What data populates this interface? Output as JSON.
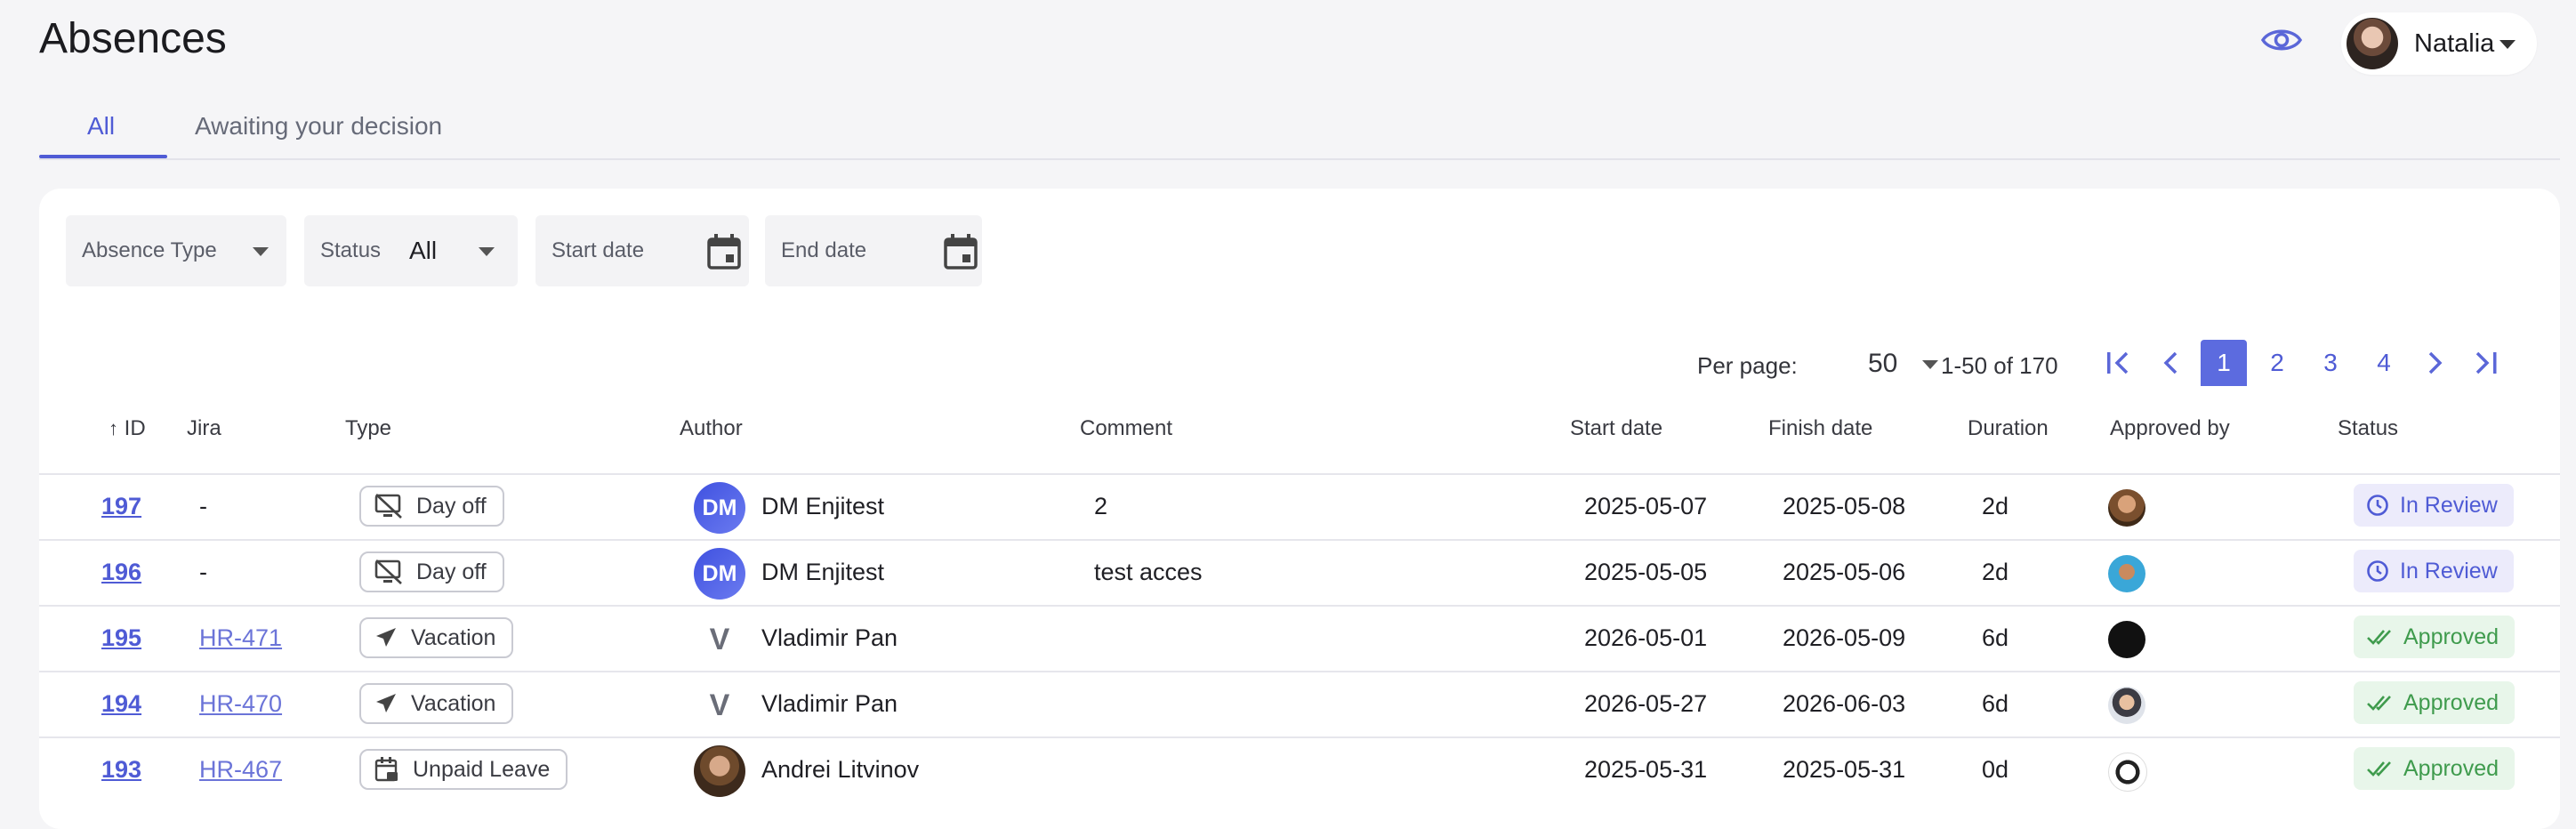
{
  "header": {
    "title": "Absences",
    "user_name": "Natalia"
  },
  "tabs": [
    {
      "label": "All",
      "active": true
    },
    {
      "label": "Awaiting your decision",
      "active": false
    }
  ],
  "filters": {
    "absence_type": {
      "label": "Absence Type"
    },
    "status": {
      "label": "Status",
      "value": "All"
    },
    "start_date": {
      "placeholder": "Start date"
    },
    "end_date": {
      "placeholder": "End date"
    }
  },
  "pagination": {
    "per_page_label": "Per page:",
    "per_page_value": "50",
    "range": "1-50 of 170",
    "pages": [
      "1",
      "2",
      "3",
      "4"
    ],
    "current_page": "1"
  },
  "columns": {
    "id": "ID",
    "jira": "Jira",
    "type": "Type",
    "author": "Author",
    "comment": "Comment",
    "start_date": "Start date",
    "finish_date": "Finish date",
    "duration": "Duration",
    "approved_by": "Approved by",
    "status": "Status"
  },
  "rows": [
    {
      "id": "197",
      "jira": "-",
      "type": "Day off",
      "type_icon": "day-off-icon",
      "author_initials": "DM",
      "author": "DM Enjitest",
      "comment": "2",
      "start": "2025-05-07",
      "finish": "2025-05-08",
      "duration": "2d",
      "status": "In Review",
      "status_kind": "review"
    },
    {
      "id": "196",
      "jira": "-",
      "type": "Day off",
      "type_icon": "day-off-icon",
      "author_initials": "DM",
      "author": "DM Enjitest",
      "comment": "test acces",
      "start": "2025-05-05",
      "finish": "2025-05-06",
      "duration": "2d",
      "status": "In Review",
      "status_kind": "review"
    },
    {
      "id": "195",
      "jira": "HR-471",
      "type": "Vacation",
      "type_icon": "airplane-icon",
      "author_initials": "V",
      "author": "Vladimir Pan",
      "comment": "",
      "start": "2026-05-01",
      "finish": "2026-05-09",
      "duration": "6d",
      "status": "Approved",
      "status_kind": "approved"
    },
    {
      "id": "194",
      "jira": "HR-470",
      "type": "Vacation",
      "type_icon": "airplane-icon",
      "author_initials": "V",
      "author": "Vladimir Pan",
      "comment": "",
      "start": "2026-05-27",
      "finish": "2026-06-03",
      "duration": "6d",
      "status": "Approved",
      "status_kind": "approved"
    },
    {
      "id": "193",
      "jira": "HR-467",
      "type": "Unpaid Leave",
      "type_icon": "calendar-lock-icon",
      "author_initials": "",
      "author": "Andrei Litvinov",
      "comment": "",
      "start": "2025-05-31",
      "finish": "2025-05-31",
      "duration": "0d",
      "status": "Approved",
      "status_kind": "approved"
    }
  ],
  "colors": {
    "accent": "#4f5bd5",
    "review_bg": "#ecebfb",
    "approved_bg": "#e8f6ea",
    "approved_text": "#3f9b4d"
  }
}
